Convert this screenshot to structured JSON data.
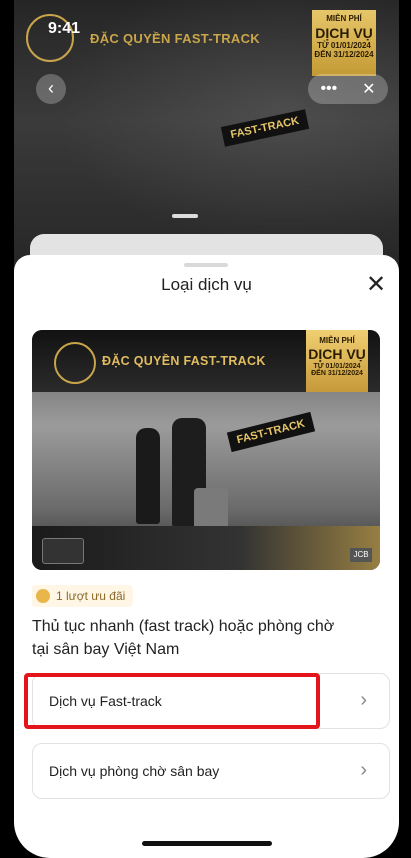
{
  "background": {
    "time": "9:41",
    "title": "ĐẶC QUYỀN FAST-TRACK",
    "badge_top": "MIỄN PHÍ",
    "badge_main": "DỊCH VỤ",
    "badge_from": "TỪ 01/01/2024",
    "badge_to": "ĐẾN 31/12/2024",
    "sign": "FAST-TRACK"
  },
  "sheet": {
    "title": "Loại dịch vụ",
    "close_icon": "close-icon",
    "banner": {
      "title": "ĐẶC QUYỀN FAST-TRACK",
      "badge_top": "MIỄN PHÍ",
      "badge_main": "DỊCH VỤ",
      "badge_from": "TỪ 01/01/2024",
      "badge_to": "ĐẾN 31/12/2024",
      "sign": "FAST-TRACK",
      "brand": "JCB"
    },
    "offer_label": "1 lượt ưu đãi",
    "description_line1": "Thủ tục nhanh (fast track) hoặc phòng chờ",
    "description_line2": "tại sân bay Việt Nam",
    "options": [
      {
        "label": "Dịch vụ Fast-track",
        "icon": "chevron-right-icon",
        "highlighted": true
      },
      {
        "label": "Dịch vụ phòng chờ sân bay",
        "icon": "chevron-right-icon",
        "highlighted": false
      }
    ],
    "highlight_color": "#e3141b"
  }
}
